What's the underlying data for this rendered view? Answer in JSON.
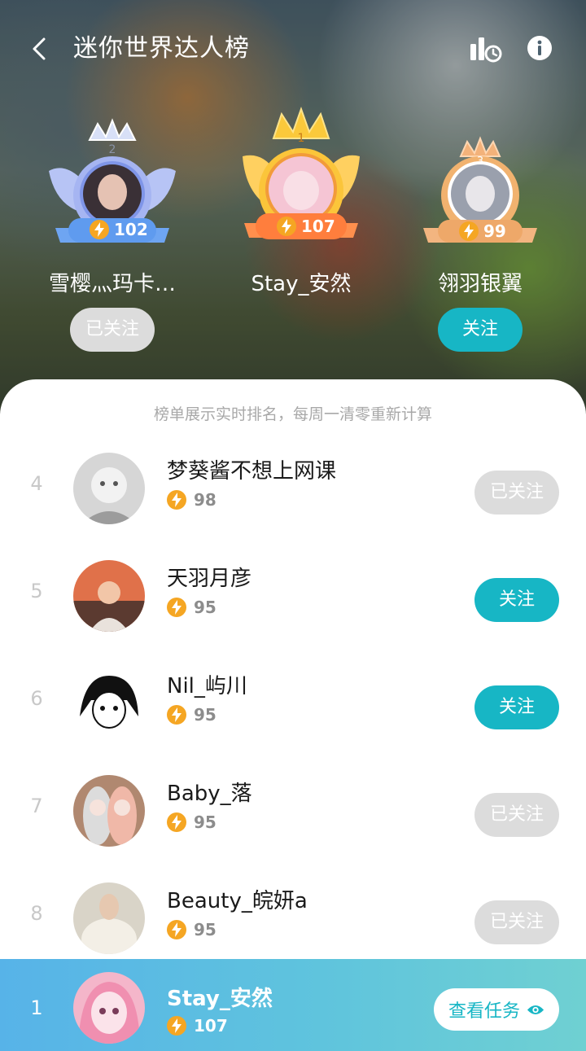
{
  "header": {
    "title": "迷你世界达人榜"
  },
  "notice": "榜单展示实时排名，每周一清零重新计算",
  "podium": [
    {
      "rank": "2",
      "name": "雪樱灬玛卡…",
      "score": "102",
      "button": "已关注",
      "state": "followed",
      "medal_color": "#8aa0ee"
    },
    {
      "rank": "1",
      "name": "Stay_安然",
      "score": "107",
      "button": "",
      "state": "self",
      "medal_color": "#f7b733"
    },
    {
      "rank": "3",
      "name": "翎羽银翼",
      "score": "99",
      "button": "关注",
      "state": "follow",
      "medal_color": "#eea869"
    }
  ],
  "list": [
    {
      "rank": "4",
      "name": "梦葵酱不想上网课",
      "score": "98",
      "button": "已关注",
      "state": "followed"
    },
    {
      "rank": "5",
      "name": "天羽月彦",
      "score": "95",
      "button": "关注",
      "state": "follow"
    },
    {
      "rank": "6",
      "name": "Nil_屿川",
      "score": "95",
      "button": "关注",
      "state": "follow"
    },
    {
      "rank": "7",
      "name": "Baby_落",
      "score": "95",
      "button": "已关注",
      "state": "followed"
    },
    {
      "rank": "8",
      "name": "Beauty_皖妍a",
      "score": "95",
      "button": "已关注",
      "state": "followed"
    }
  ],
  "self": {
    "rank": "1",
    "name": "Stay_安然",
    "score": "107",
    "button": "查看任务"
  },
  "colors": {
    "accent": "#17b6c5",
    "followed_bg": "#dcdcdc",
    "bolt": "#f5a623"
  }
}
